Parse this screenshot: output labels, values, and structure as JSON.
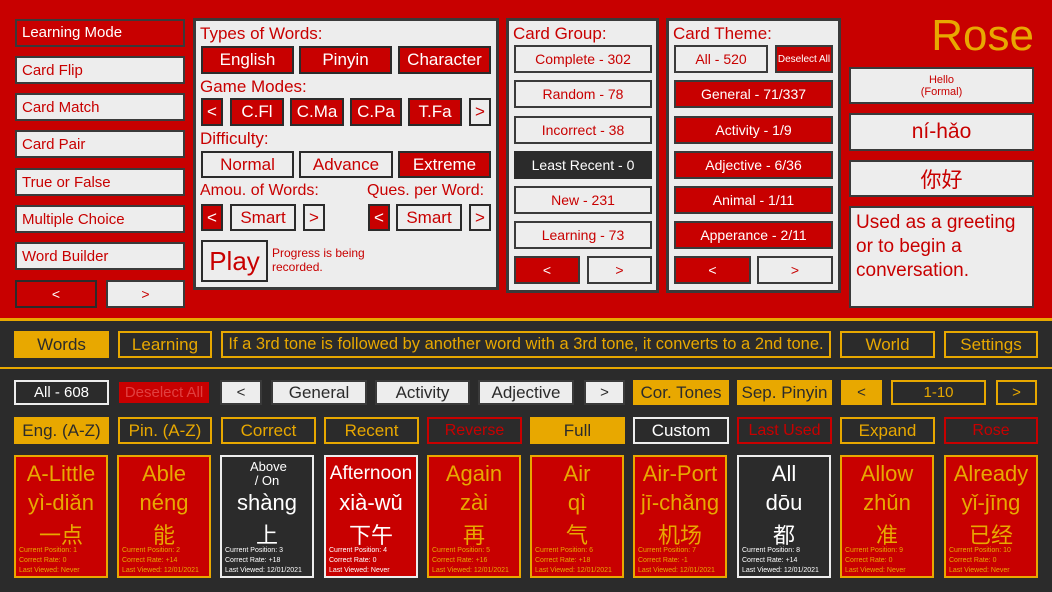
{
  "title": "Rose",
  "colors": {
    "red": "#c80000",
    "dark": "#2b2b2b",
    "gold": "#e8a800",
    "light": "#ededed"
  },
  "left_menu": {
    "items": [
      "Learning Mode",
      "Card Flip",
      "Card Match",
      "Card Pair",
      "True or False",
      "Multiple Choice",
      "Word Builder"
    ],
    "prev": "<",
    "next": ">"
  },
  "settings_panel": {
    "types_label": "Types of Words:",
    "types": [
      "English",
      "Pinyin",
      "Character"
    ],
    "modes_label": "Game Modes:",
    "modes": [
      "C.Fl",
      "C.Ma",
      "C.Pa",
      "T.Fa"
    ],
    "prev": "<",
    "next": ">",
    "difficulty_label": "Difficulty:",
    "difficulty": [
      "Normal",
      "Advance",
      "Extreme"
    ],
    "amount_label": "Amou. of Words:",
    "amount_value": "Smart",
    "ques_label": "Ques. per Word:",
    "ques_value": "Smart",
    "play": "Play",
    "progress_note": "Progress is being recorded."
  },
  "card_group": {
    "label": "Card Group:",
    "items": [
      "Complete - 302",
      "Random - 78",
      "Incorrect - 38",
      "Least Recent - 0",
      "New - 231",
      "Learning - 73"
    ],
    "prev": "<",
    "next": ">"
  },
  "card_theme": {
    "label": "Card Theme:",
    "all": "All - 520",
    "deselect": "Deselect All",
    "items": [
      "General - 71/337",
      "Activity - 1/9",
      "Adjective - 6/36",
      "Animal - 1/11",
      "Apperance - 2/11"
    ],
    "prev": "<",
    "next": ">"
  },
  "word_detail": {
    "english": "Hello (Formal)",
    "pinyin": "ní-hǎo",
    "character": "你好",
    "description": "Used as a greeting or to begin a conversation."
  },
  "nav": {
    "words": "Words",
    "learning": "Learning",
    "tip": "If a 3rd tone is followed by another word with a 3rd tone, it converts to a 2nd tone.",
    "world": "World",
    "settings": "Settings"
  },
  "filters": {
    "all": "All - 608",
    "deselect": "Deselect All",
    "prev": "<",
    "themes": [
      "General",
      "Activity",
      "Adjective"
    ],
    "next": ">",
    "cor_tones": "Cor. Tones",
    "sep_pinyin": "Sep. Pinyin",
    "page_prev": "<",
    "page": "1-10",
    "page_next": ">"
  },
  "sorts": {
    "eng": "Eng. (A-Z)",
    "pin": "Pin. (A-Z)",
    "correct": "Correct",
    "recent": "Recent",
    "reverse": "Reverse",
    "full": "Full",
    "custom": "Custom",
    "last_used": "Last Used",
    "expand": "Expand",
    "rose": "Rose"
  },
  "cards": [
    {
      "en": "A-Little",
      "py": "yì-diǎn",
      "zh": "一点",
      "pos": "Current Position: 1",
      "rate": "Correct Rate: 0",
      "viewed": "Last Viewed: Never"
    },
    {
      "en": "Able",
      "py": "néng",
      "zh": "能",
      "pos": "Current Position: 2",
      "rate": "Correct Rate: +14",
      "viewed": "Last Viewed: 12/01/2021"
    },
    {
      "en": "Above / On",
      "py": "shàng",
      "zh": "上",
      "pos": "Current Position: 3",
      "rate": "Correct Rate: +18",
      "viewed": "Last Viewed: 12/01/2021"
    },
    {
      "en": "Afternoon",
      "py": "xià-wǔ",
      "zh": "下午",
      "pos": "Current Position: 4",
      "rate": "Correct Rate: 0",
      "viewed": "Last Viewed: Never"
    },
    {
      "en": "Again",
      "py": "zài",
      "zh": "再",
      "pos": "Current Position: 5",
      "rate": "Correct Rate: +16",
      "viewed": "Last Viewed: 12/01/2021"
    },
    {
      "en": "Air",
      "py": "qì",
      "zh": "气",
      "pos": "Current Position: 6",
      "rate": "Correct Rate: +18",
      "viewed": "Last Viewed: 12/01/2021"
    },
    {
      "en": "Air-Port",
      "py": "jī-chǎng",
      "zh": "机场",
      "pos": "Current Position: 7",
      "rate": "Correct Rate: -1",
      "viewed": "Last Viewed: 12/01/2021"
    },
    {
      "en": "All",
      "py": "dōu",
      "zh": "都",
      "pos": "Current Position: 8",
      "rate": "Correct Rate: +14",
      "viewed": "Last Viewed: 12/01/2021"
    },
    {
      "en": "Allow",
      "py": "zhǔn",
      "zh": "准",
      "pos": "Current Position: 9",
      "rate": "Correct Rate: 0",
      "viewed": "Last Viewed: Never"
    },
    {
      "en": "Already",
      "py": "yǐ-jīng",
      "zh": "已经",
      "pos": "Current Position: 10",
      "rate": "Correct Rate: 0",
      "viewed": "Last Viewed: Never"
    }
  ]
}
